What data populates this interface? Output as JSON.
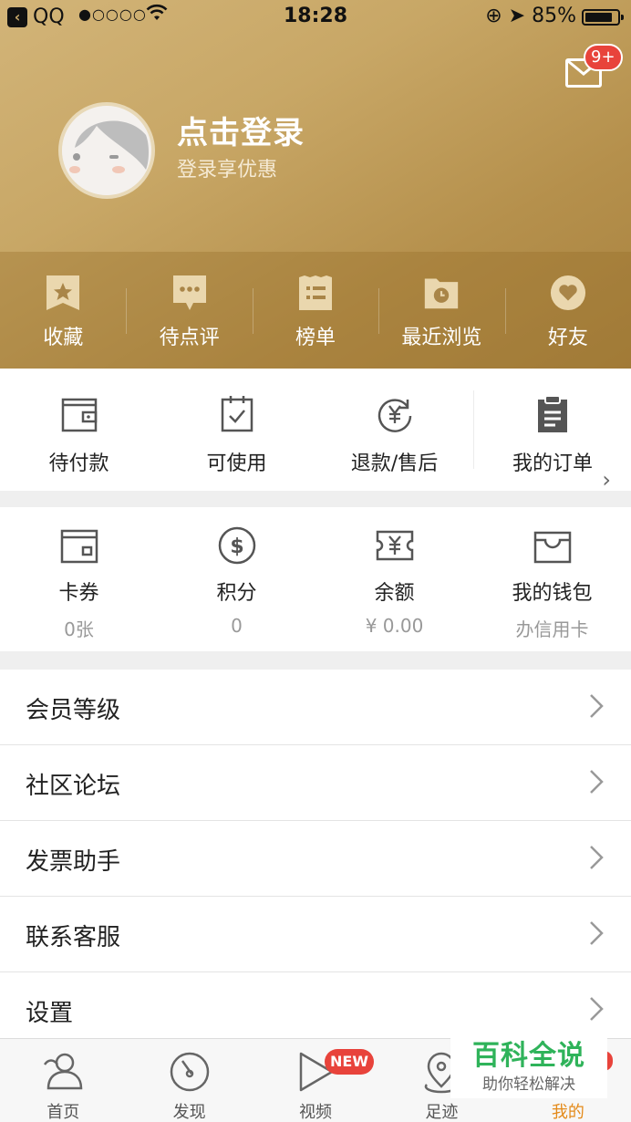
{
  "status_bar": {
    "back_app": "QQ",
    "signal": "●○○○○",
    "time": "18:28",
    "battery_text": "85%",
    "battery_level": 0.85
  },
  "header": {
    "mail_badge": "9+",
    "login_title": "点击登录",
    "login_subtitle": "登录享优惠"
  },
  "quick_items": [
    {
      "label": "收藏",
      "icon": "star-bookmark-icon"
    },
    {
      "label": "待点评",
      "icon": "comment-icon"
    },
    {
      "label": "榜单",
      "icon": "list-icon"
    },
    {
      "label": "最近浏览",
      "icon": "history-icon"
    },
    {
      "label": "好友",
      "icon": "heart-icon"
    }
  ],
  "orders": {
    "items": [
      {
        "label": "待付款",
        "icon": "wallet-icon"
      },
      {
        "label": "可使用",
        "icon": "checklist-icon"
      },
      {
        "label": "退款/售后",
        "icon": "refund-icon"
      },
      {
        "label": "我的订单",
        "icon": "clipboard-icon"
      }
    ],
    "chevron": "›"
  },
  "wallet": [
    {
      "label": "卡券",
      "value": "0张",
      "icon": "card-icon"
    },
    {
      "label": "积分",
      "value": "0",
      "icon": "dollar-icon"
    },
    {
      "label": "余额",
      "value": "¥ 0.00",
      "icon": "ticket-icon"
    },
    {
      "label": "我的钱包",
      "value": "办信用卡",
      "icon": "purse-icon"
    }
  ],
  "menu": [
    {
      "label": "会员等级"
    },
    {
      "label": "社区论坛"
    },
    {
      "label": "发票助手"
    },
    {
      "label": "联系客服"
    },
    {
      "label": "设置"
    }
  ],
  "tabbar": {
    "items": [
      {
        "label": "首页",
        "icon": "home-icon"
      },
      {
        "label": "发现",
        "icon": "discover-icon"
      },
      {
        "label": "视频",
        "icon": "play-icon"
      },
      {
        "label": "足迹",
        "icon": "location-icon"
      },
      {
        "label": "我的",
        "icon": "profile-icon"
      }
    ],
    "new_badge": "NEW",
    "active": "我的"
  },
  "watermark": {
    "title": "百科全说",
    "subtitle": "助你轻松解决"
  },
  "colors": {
    "gold": "#c8a766",
    "accent_red": "#e8433b",
    "tab_active": "#e48a1a",
    "watermark_green": "#2fb35a"
  }
}
